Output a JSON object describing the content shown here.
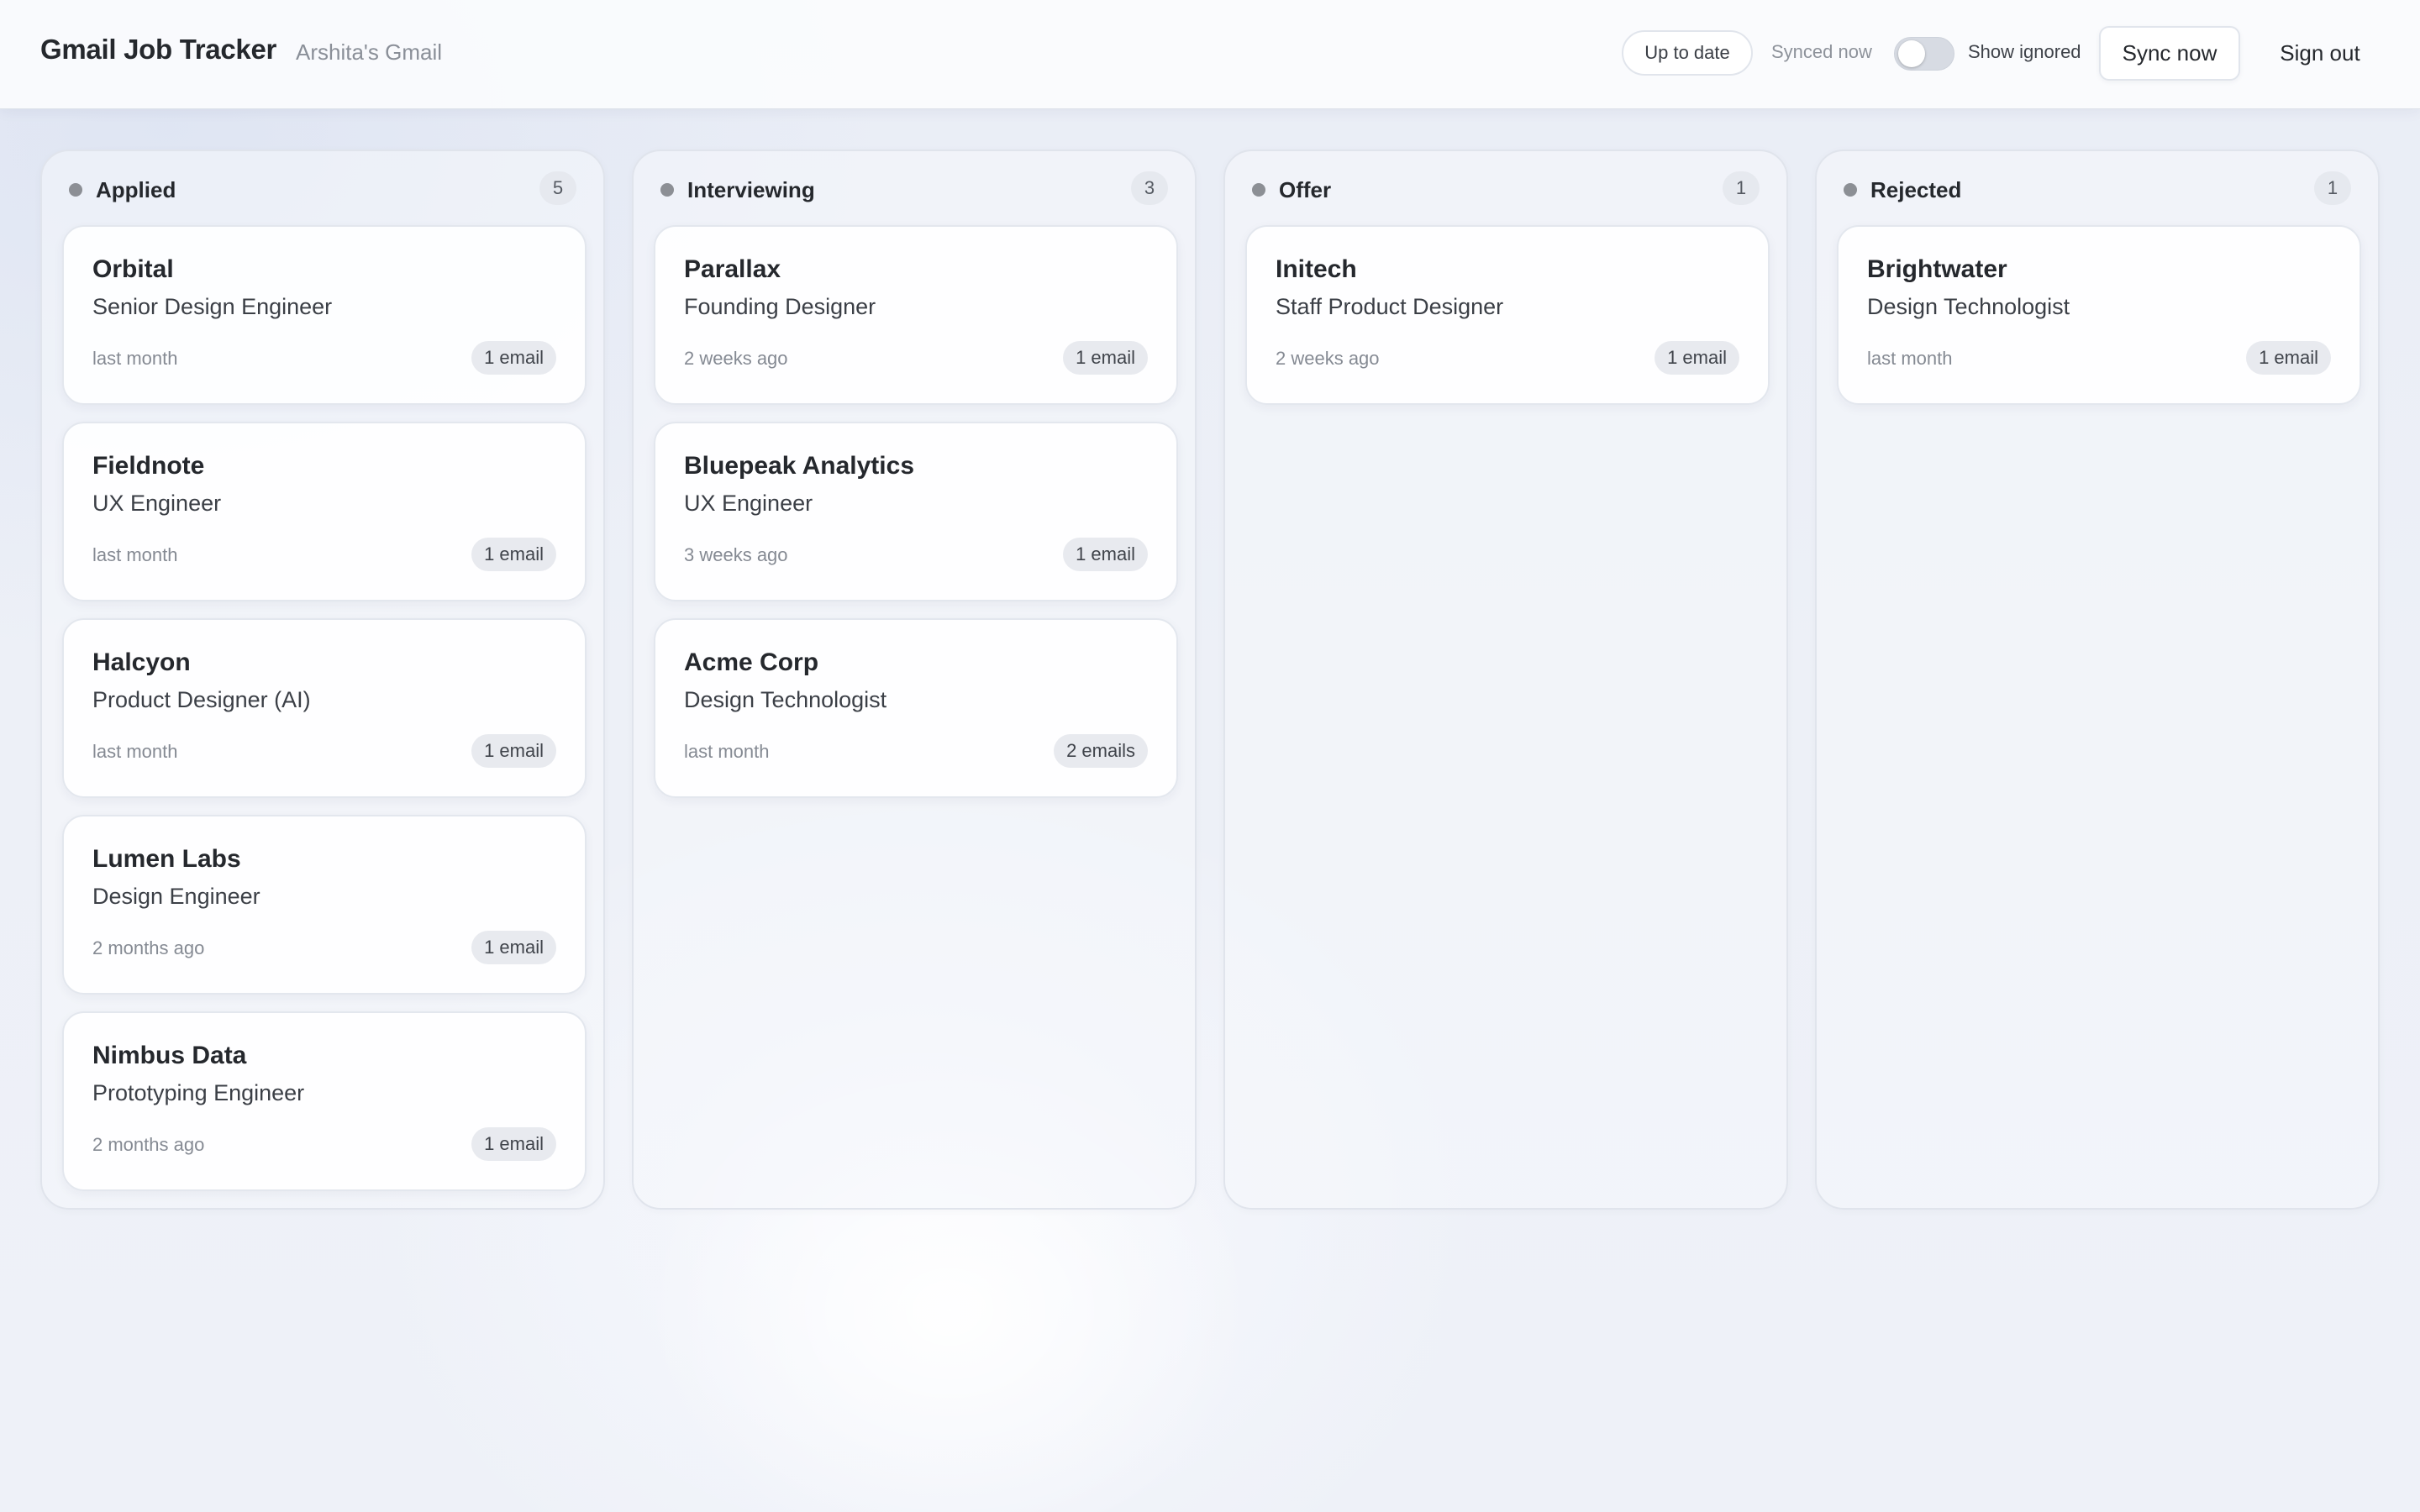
{
  "header": {
    "title": "Gmail Job Tracker",
    "account": "Arshita's Gmail",
    "status": "Up to date",
    "synced_label": "Synced now",
    "show_ignored_label": "Show ignored",
    "show_ignored_on": false,
    "sync_button": "Sync now",
    "signout_button": "Sign out"
  },
  "columns": [
    {
      "title": "Applied",
      "count": "5",
      "cards": [
        {
          "company": "Orbital",
          "role": "Senior Design Engineer",
          "time": "last month",
          "emails": "1 email"
        },
        {
          "company": "Fieldnote",
          "role": "UX Engineer",
          "time": "last month",
          "emails": "1 email"
        },
        {
          "company": "Halcyon",
          "role": "Product Designer (AI)",
          "time": "last month",
          "emails": "1 email"
        },
        {
          "company": "Lumen Labs",
          "role": "Design Engineer",
          "time": "2 months ago",
          "emails": "1 email"
        },
        {
          "company": "Nimbus Data",
          "role": "Prototyping Engineer",
          "time": "2 months ago",
          "emails": "1 email"
        }
      ]
    },
    {
      "title": "Interviewing",
      "count": "3",
      "cards": [
        {
          "company": "Parallax",
          "role": "Founding Designer",
          "time": "2 weeks ago",
          "emails": "1 email"
        },
        {
          "company": "Bluepeak Analytics",
          "role": "UX Engineer",
          "time": "3 weeks ago",
          "emails": "1 email"
        },
        {
          "company": "Acme Corp",
          "role": "Design Technologist",
          "time": "last month",
          "emails": "2 emails"
        }
      ]
    },
    {
      "title": "Offer",
      "count": "1",
      "cards": [
        {
          "company": "Initech",
          "role": "Staff Product Designer",
          "time": "2 weeks ago",
          "emails": "1 email"
        }
      ]
    },
    {
      "title": "Rejected",
      "count": "1",
      "cards": [
        {
          "company": "Brightwater",
          "role": "Design Technologist",
          "time": "last month",
          "emails": "1 email"
        }
      ]
    }
  ]
}
